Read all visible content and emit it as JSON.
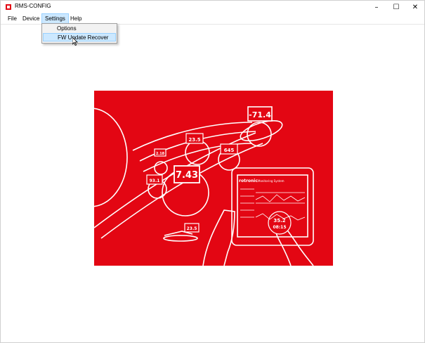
{
  "window": {
    "title": "RMS-CONFIG"
  },
  "menu": {
    "items": [
      "File",
      "Device",
      "Settings",
      "Help"
    ],
    "open": "Settings",
    "dropdown": [
      "Options",
      "FW Update Recover"
    ]
  },
  "banner": {
    "brand": "rotronic",
    "product": "Monitoring System",
    "readouts": [
      "-71.4",
      "23.5",
      "645",
      "2.18",
      "7.43",
      "93.1",
      "23.5"
    ],
    "tablet_value": "35.2",
    "tablet_time": "08:15"
  },
  "colors": {
    "banner_red": "#e30613",
    "menu_highlight": "#cce8ff"
  }
}
